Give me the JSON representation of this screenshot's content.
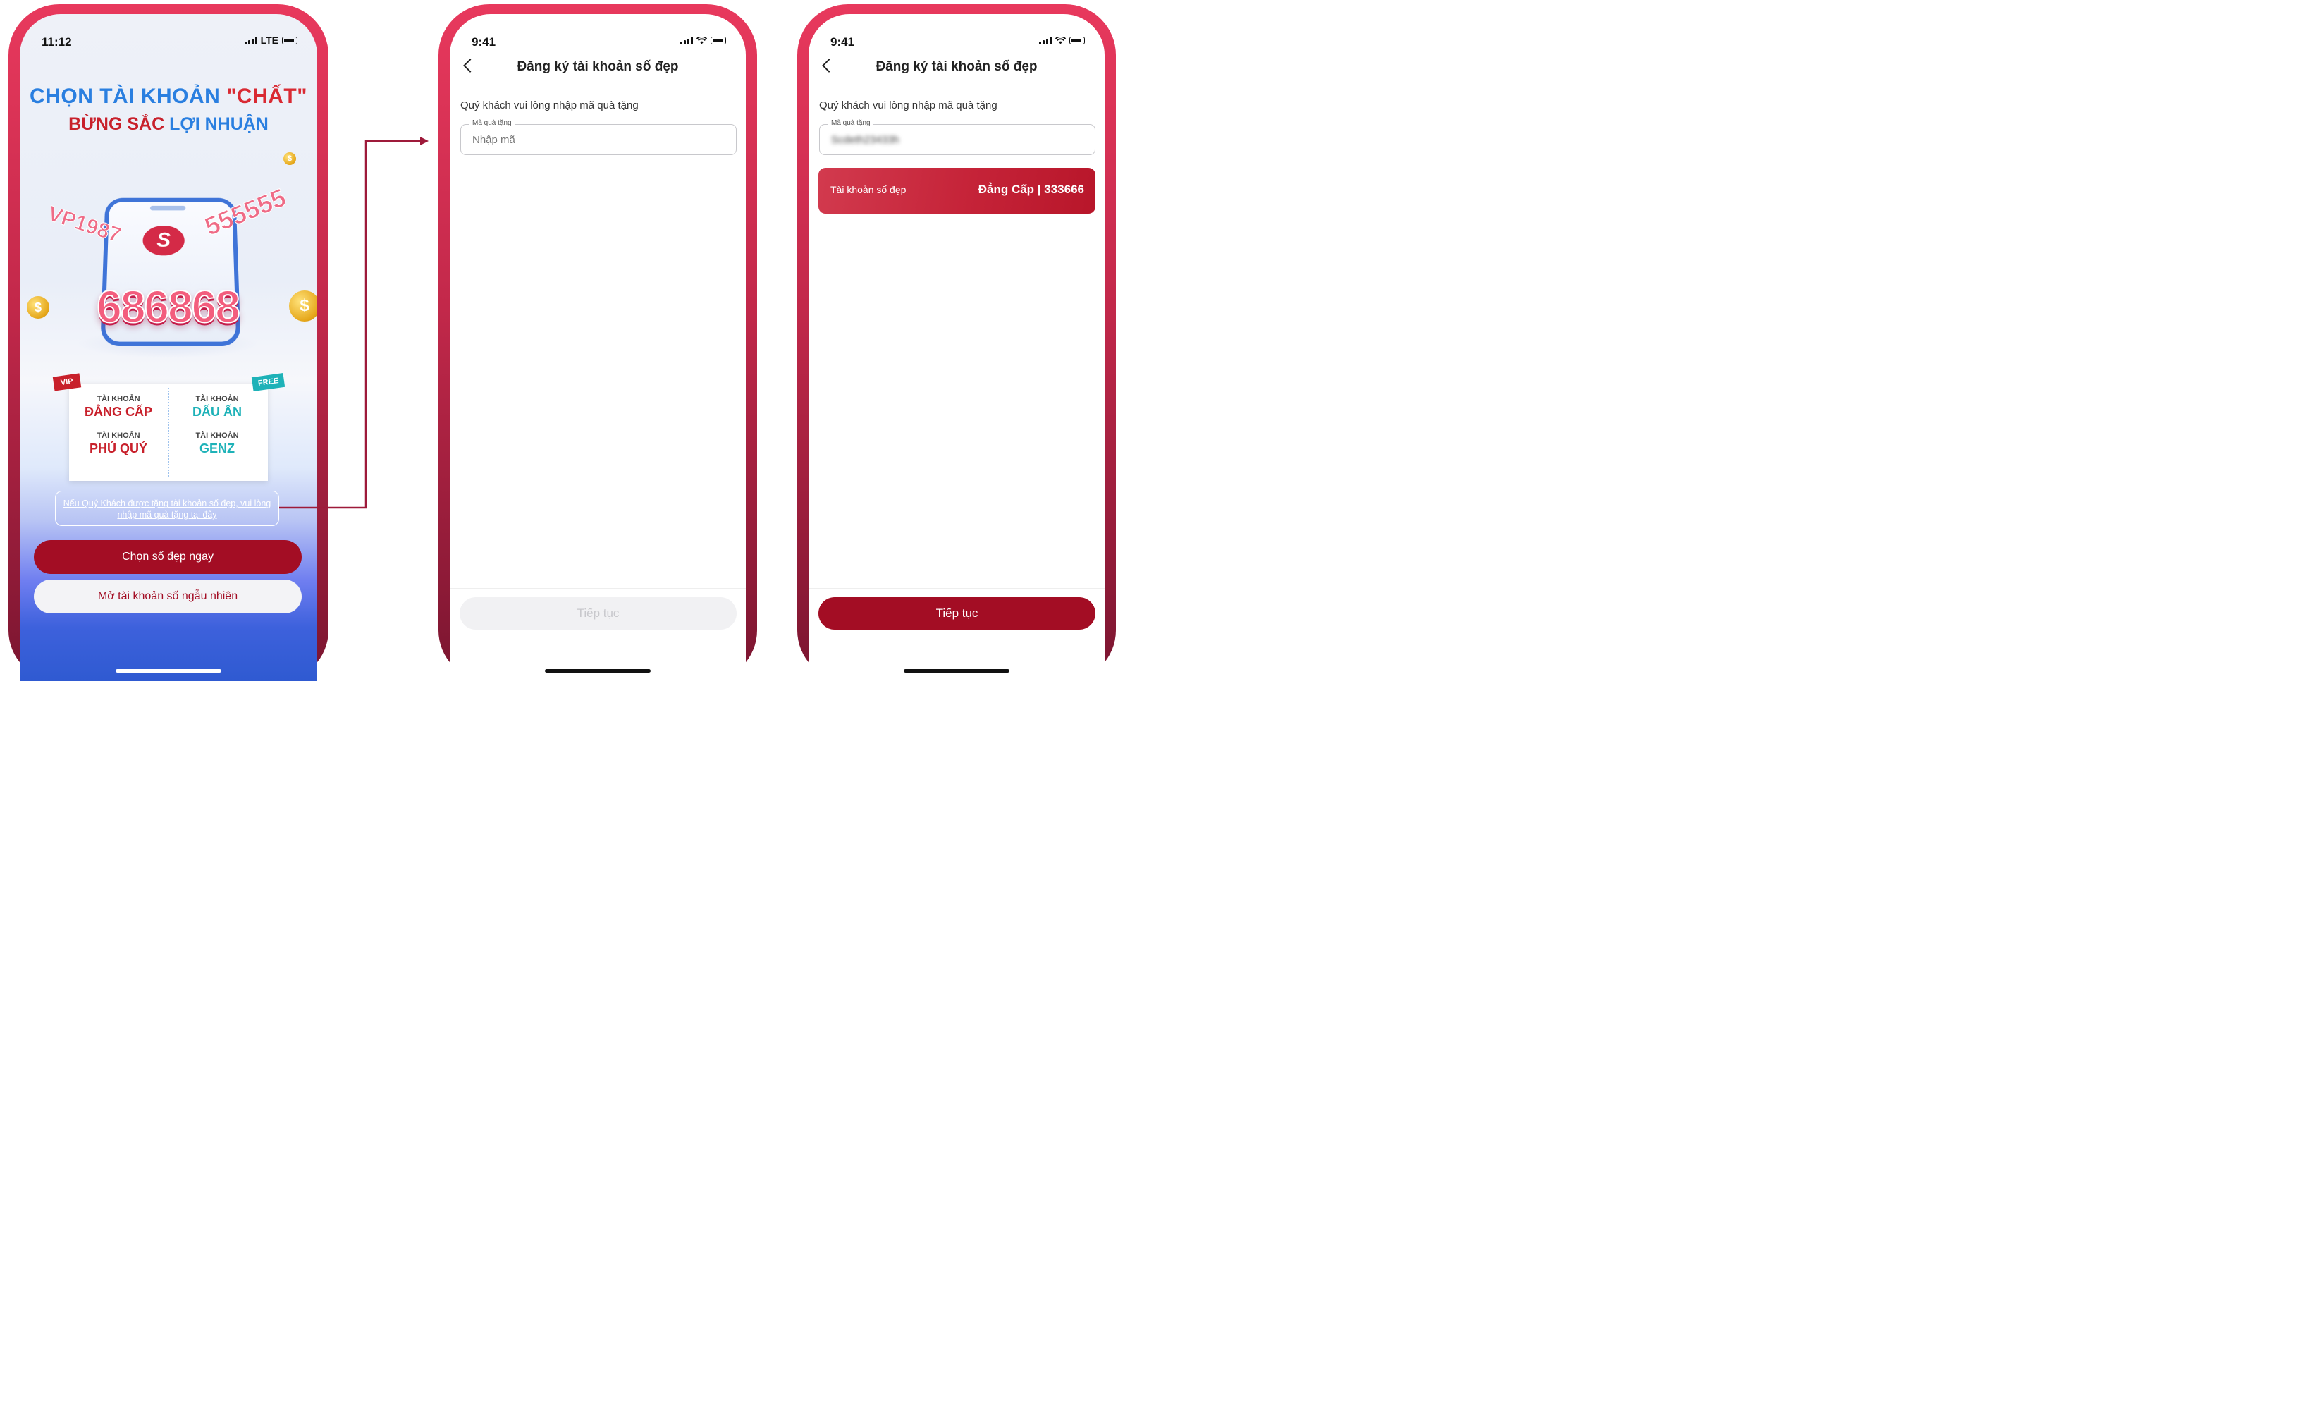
{
  "phone1": {
    "status": {
      "time": "11:12",
      "network": "LTE"
    },
    "hero": {
      "title_line1_a": "CHỌN TÀI KHOẢN ",
      "title_line1_b": "\"CHẤT\"",
      "title_line2_a": "BỪNG SẮC ",
      "title_line2_b": "LỢI NHUẬN",
      "number_left": "VP1987",
      "number_right": "555555",
      "number_main": "686868",
      "logo_letter": "S",
      "coin_symbol": "$"
    },
    "ticket": {
      "ribbon_left": "VIP",
      "ribbon_right": "FREE",
      "cells": [
        {
          "label": "TÀI KHOẢN",
          "value": "ĐẲNG CẤP"
        },
        {
          "label": "TÀI KHOẢN",
          "value": "DẤU ẤN"
        },
        {
          "label": "TÀI KHOẢN",
          "value": "PHÚ QUÝ"
        },
        {
          "label": "TÀI KHOẢN",
          "value": "GENZ"
        }
      ]
    },
    "gift_link": "Nếu Quý Khách được tặng tài khoản số đẹp, vui lòng nhập mã quà tặng tại đây",
    "primary_button": "Chọn số đẹp ngay",
    "secondary_button": "Mở tài khoản số ngẫu nhiên"
  },
  "phone2": {
    "status": {
      "time": "9:41"
    },
    "title": "Đăng ký tài khoản số đẹp",
    "prompt": "Quý khách vui lòng nhập mã quà tặng",
    "field_label": "Mã quà tặng",
    "field_placeholder": "Nhập mã",
    "continue_button": "Tiếp tục"
  },
  "phone3": {
    "status": {
      "time": "9:41"
    },
    "title": "Đăng ký tài khoản số đẹp",
    "prompt": "Quý khách vui lòng nhập mã quà tặng",
    "field_label": "Mã quà tặng",
    "field_value": "Scdeth23433h",
    "result_label": "Tài khoản số đẹp",
    "result_value": "Đẳng Cấp | 333666",
    "continue_button": "Tiếp tục"
  },
  "colors": {
    "brand_red": "#a30d24",
    "frame_pink": "#e8395d",
    "accent_blue": "#2a7fe0",
    "accent_teal": "#1eb2b8"
  }
}
